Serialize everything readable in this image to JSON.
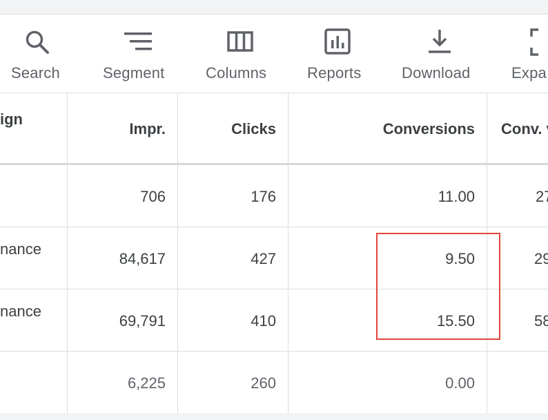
{
  "toolbar": {
    "items": [
      {
        "label": "Search",
        "icon": "search-icon"
      },
      {
        "label": "Segment",
        "icon": "segment-icon"
      },
      {
        "label": "Columns",
        "icon": "columns-icon"
      },
      {
        "label": "Reports",
        "icon": "reports-icon"
      },
      {
        "label": "Download",
        "icon": "download-icon"
      },
      {
        "label": "Expa",
        "icon": "expand-icon"
      }
    ]
  },
  "table": {
    "headers": {
      "campaign": "ign",
      "impr": "Impr.",
      "clicks": "Clicks",
      "conversions": "Conversions",
      "conv_value": "Conv. v"
    },
    "rows": [
      {
        "campaign": "",
        "impr": "706",
        "clicks": "176",
        "conversions": "11.00",
        "conv_value": "27"
      },
      {
        "campaign": "nance",
        "impr": "84,617",
        "clicks": "427",
        "conversions": "9.50",
        "conv_value": "29"
      },
      {
        "campaign": "nance",
        "impr": "69,791",
        "clicks": "410",
        "conversions": "15.50",
        "conv_value": "58"
      },
      {
        "campaign": "",
        "impr": "6,225",
        "clicks": "260",
        "conversions": "0.00",
        "conv_value": ""
      }
    ]
  },
  "colors": {
    "highlight_border": "#e0453a",
    "grid_line": "#dadce0",
    "icon": "#5f6368"
  }
}
